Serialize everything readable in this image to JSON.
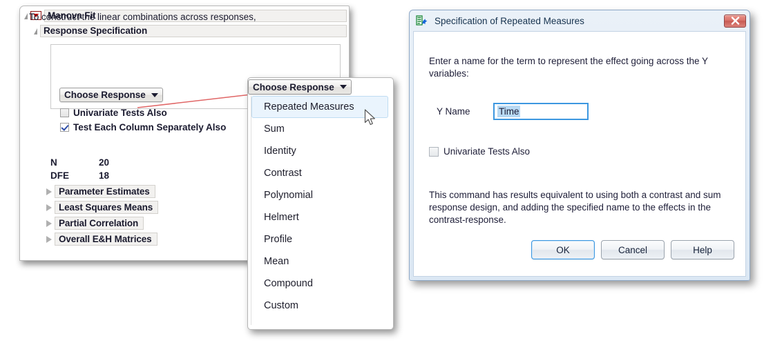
{
  "report": {
    "manova_title": "Manova Fit",
    "response_spec_title": "Response Specification",
    "instruction": "To construct the linear combinations across responses,",
    "choose_response_label": "Choose Response",
    "checkboxes": [
      {
        "label": "Univariate Tests Also",
        "checked": false
      },
      {
        "label": "Test Each Column Separately Also",
        "checked": true
      }
    ],
    "stats": [
      {
        "label": "N",
        "value": "20"
      },
      {
        "label": "DFE",
        "value": "18"
      }
    ],
    "collapsed_sections": [
      "Parameter Estimates",
      "Least Squares Means",
      "Partial Correlation",
      "Overall E&H Matrices"
    ]
  },
  "menu": {
    "header_label": "Choose Response",
    "items": [
      "Repeated Measures",
      "Sum",
      "Identity",
      "Contrast",
      "Polynomial",
      "Helmert",
      "Profile",
      "Mean",
      "Compound",
      "Custom"
    ],
    "selected_index": 0,
    "highlight_color": "#eaf4fd"
  },
  "dialog": {
    "title": "Specification of Repeated Measures",
    "close_label": "Close",
    "prompt": "Enter a name for the term to represent the effect going across the Y variables:",
    "yname_label": "Y Name",
    "yname_value": "Time",
    "yname_selected": true,
    "checkbox": {
      "label": "Univariate Tests Also",
      "checked": false
    },
    "description": "This command has results equivalent to using both a contrast and sum response design, and adding the specified name to the effects in the contrast-response.",
    "buttons": [
      {
        "label": "OK",
        "default": true
      },
      {
        "label": "Cancel",
        "default": false
      },
      {
        "label": "Help",
        "default": false
      }
    ]
  },
  "annotation": {
    "arrow_color": "#e06666"
  }
}
